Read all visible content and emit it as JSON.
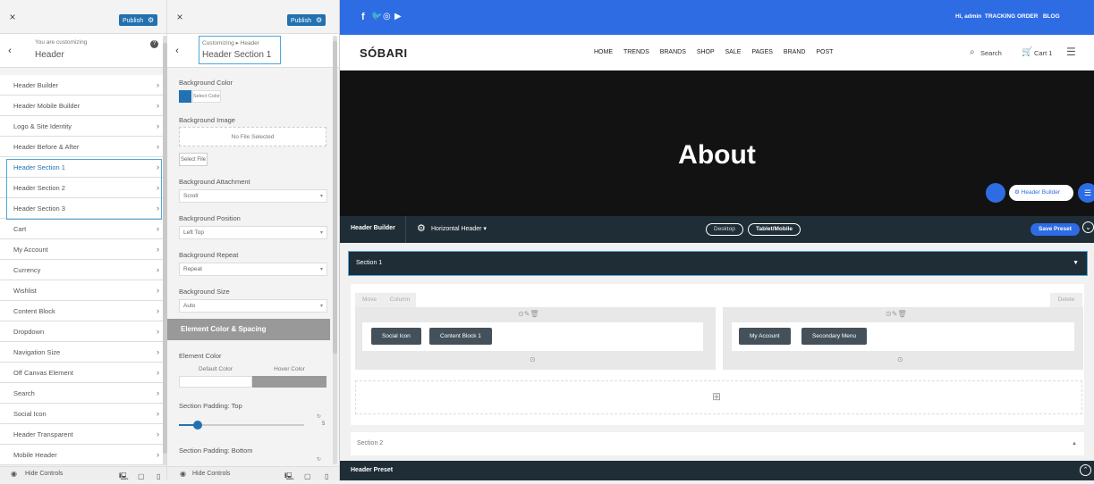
{
  "panel1": {
    "close": "×",
    "publish": "Publish",
    "customizing_label": "You are customizing",
    "customizing_title": "Header",
    "help": "?",
    "items": [
      {
        "label": "Header Builder"
      },
      {
        "label": "Header Mobile Builder"
      },
      {
        "label": "Logo & Site Identity"
      },
      {
        "label": "Header Before & After"
      },
      {
        "label": "Header Section 1"
      },
      {
        "label": "Header Section 2"
      },
      {
        "label": "Header Section 3"
      },
      {
        "label": "Cart"
      },
      {
        "label": "My Account"
      },
      {
        "label": "Currency"
      },
      {
        "label": "Wishlist"
      },
      {
        "label": "Content Block"
      },
      {
        "label": "Dropdown"
      },
      {
        "label": "Navigation Size"
      },
      {
        "label": "Off Canvas Element"
      },
      {
        "label": "Search"
      },
      {
        "label": "Social Icon"
      },
      {
        "label": "Header Transparent"
      },
      {
        "label": "Mobile Header"
      }
    ],
    "hide_controls": "Hide Controls"
  },
  "panel2": {
    "close": "×",
    "publish": "Publish",
    "breadcrumb": "Customizing ▸ Header",
    "title": "Header Section 1",
    "bg_color_label": "Background Color",
    "select_color": "Select Color",
    "bg_image_label": "Background Image",
    "no_file": "No File Selected",
    "select_file": "Select File",
    "bg_attachment_label": "Background Attachment",
    "bg_attachment_value": "Scroll",
    "bg_position_label": "Background Position",
    "bg_position_value": "Left Top",
    "bg_repeat_label": "Background Repeat",
    "bg_repeat_value": "Repeat",
    "bg_size_label": "Background Size",
    "bg_size_value": "Auto",
    "section_heading": "Element Color & Spacing",
    "element_color_label": "Element Color",
    "default_color": "Default Color",
    "hover_color": "Hover Color",
    "padding_top_label": "Section Padding: Top",
    "padding_top_value": "5",
    "padding_bottom_label": "Section Padding: Bottom",
    "hide_controls": "Hide Controls",
    "accent": "#2271b1"
  },
  "preview": {
    "topbar_right": "Hi, admin  TRACKING ORDER   BLOG",
    "logo": "SÓBARI",
    "menu": [
      "HOME",
      "TRENDS",
      "BRANDS",
      "SHOP",
      "SALE",
      "PAGES",
      "BRAND",
      "POST"
    ],
    "search": "Search",
    "cart": "Cart 1",
    "hero_title": "About",
    "header_builder_chip": "Header Builder",
    "builder_label": "Header Builder",
    "horizontal_header": "Horizontal Header",
    "desktop": "Desktop",
    "tablet_mobile": "Tablet/Mobile",
    "save_preset": "Save Preset",
    "section1": "Section 1",
    "move": "Move",
    "column": "Column",
    "delete": "Delete",
    "left_items": [
      "Social Icon",
      "Content Block 1"
    ],
    "right_items": [
      "My Account",
      "Secondary Menu"
    ],
    "section2": "Section 2",
    "header_preset": "Header Preset",
    "brand_blue": "#2e6ce4",
    "dark": "#1f2d36"
  }
}
